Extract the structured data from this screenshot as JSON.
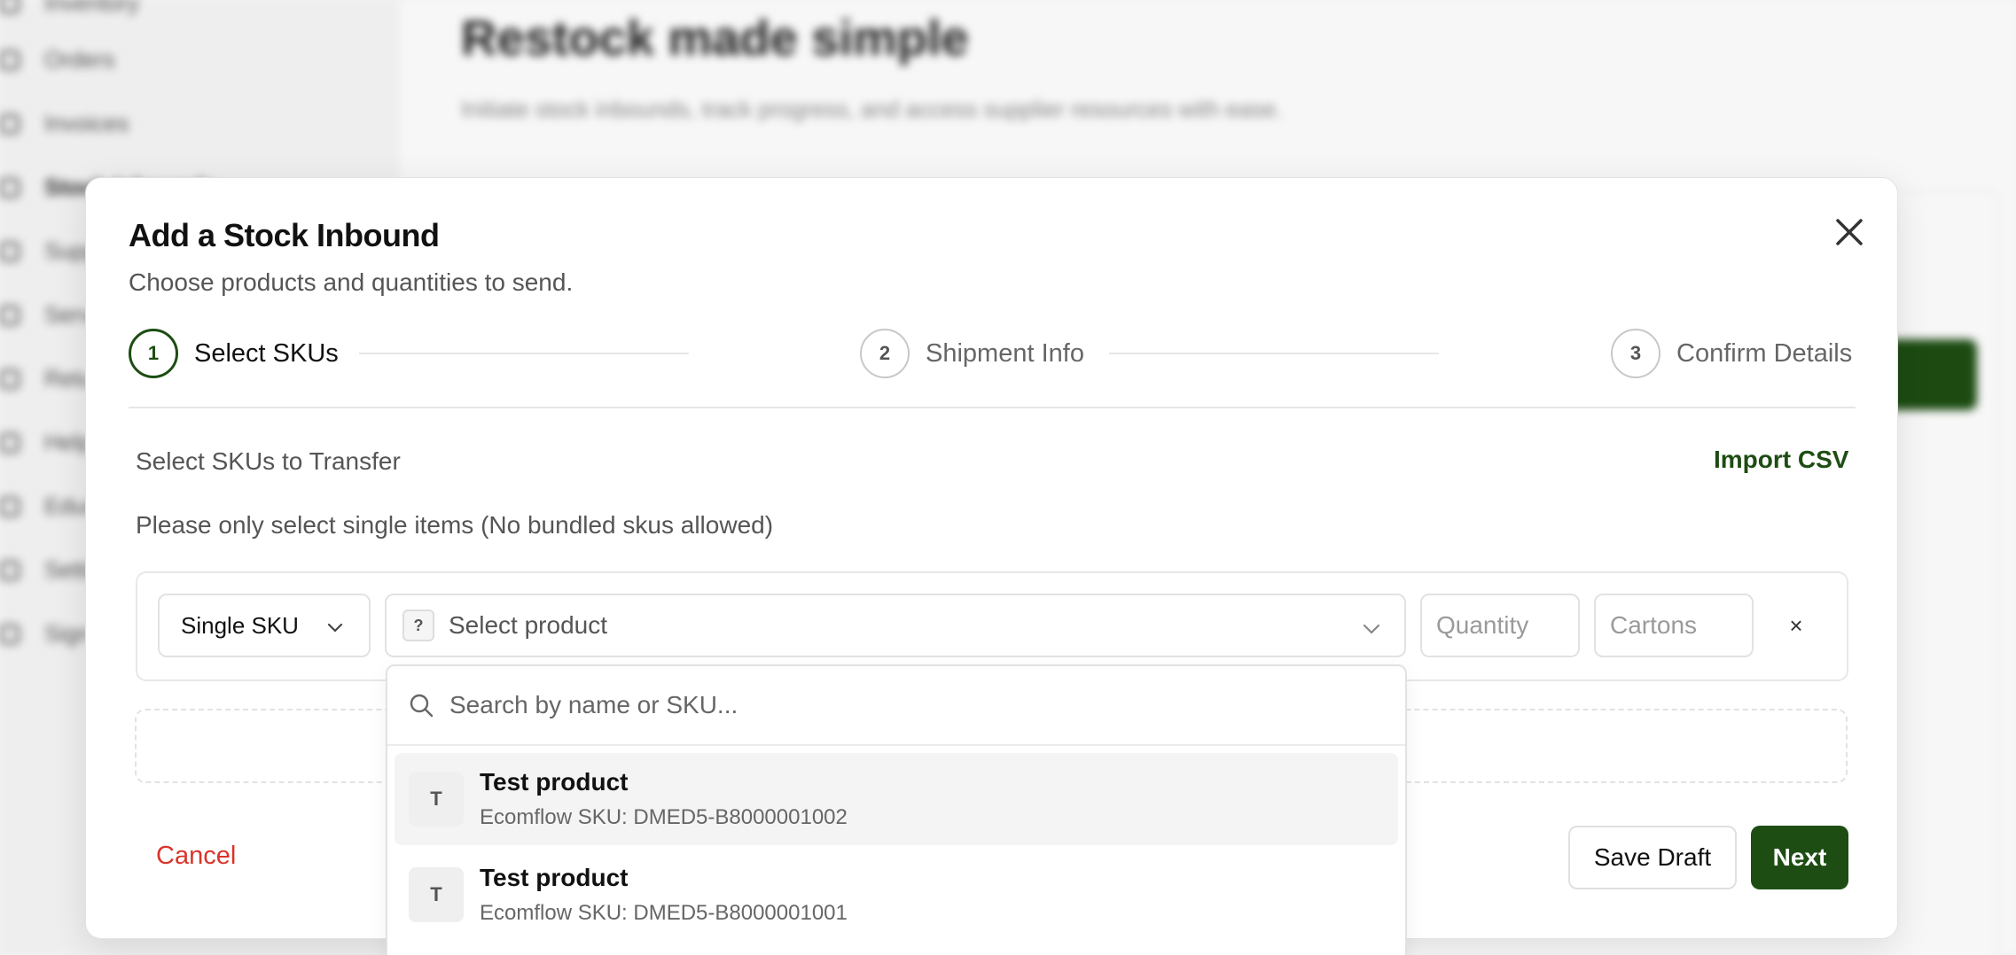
{
  "background": {
    "title": "Restock made simple",
    "subtitle": "Initiate stock inbounds, track progress, and access supplier resources with ease.",
    "nav": [
      "Inventory",
      "Orders",
      "Invoices",
      "Stock Inbounds",
      "Suppliers",
      "Service",
      "Returns",
      "Help",
      "Education",
      "Settings",
      "Sign out"
    ]
  },
  "modal": {
    "title": "Add a Stock Inbound",
    "subtitle": "Choose products and quantities to send.",
    "steps": [
      {
        "number": "1",
        "label": "Select SKUs"
      },
      {
        "number": "2",
        "label": "Shipment Info"
      },
      {
        "number": "3",
        "label": "Confirm Details"
      }
    ],
    "section_label": "Select SKUs to Transfer",
    "import_csv": "Import CSV",
    "note": "Please only select single items (No bundled skus allowed)",
    "row": {
      "type_value": "Single SKU",
      "product_badge": "?",
      "product_placeholder": "Select product",
      "quantity_placeholder": "Quantity",
      "cartons_placeholder": "Cartons",
      "remove_label": "×"
    },
    "cancel_label": "Cancel",
    "save_draft_label": "Save Draft",
    "next_label": "Next"
  },
  "dropdown": {
    "search_placeholder": "Search by name or SKU...",
    "options": [
      {
        "initial": "T",
        "name": "Test product",
        "sku": "Ecomflow SKU: DMED5-B8000001002"
      },
      {
        "initial": "T",
        "name": "Test product",
        "sku": "Ecomflow SKU: DMED5-B8000001001"
      }
    ]
  },
  "colors": {
    "accent": "#1d4d12",
    "danger": "#d9342b"
  }
}
